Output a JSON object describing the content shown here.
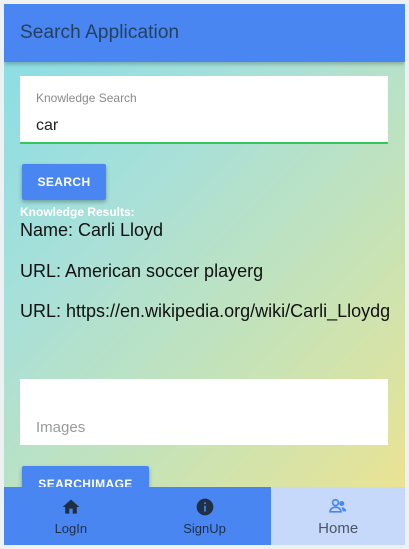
{
  "header": {
    "title": "Search Application"
  },
  "knowledge_search": {
    "label": "Knowledge Search",
    "value": "car"
  },
  "search_button": {
    "label": "SEARCH"
  },
  "results": {
    "heading": "Knowledge Results:",
    "name": "Name: Carli Lloyd",
    "description": "URL: American soccer playerg",
    "url": "URL: https://en.wikipedia.org/wiki/Carli_Lloydg"
  },
  "images_field": {
    "placeholder": "Images"
  },
  "searchimage_button": {
    "label": "SEARCHIMAGE"
  },
  "bottom_nav": {
    "items": [
      {
        "label": "LogIn",
        "icon": "home-icon"
      },
      {
        "label": "SignUp",
        "icon": "info-icon"
      },
      {
        "label": "Home",
        "icon": "people-icon",
        "active": true
      }
    ]
  },
  "colors": {
    "primary": "#4a86f2",
    "active_nav": "#c6d9fb",
    "input_underline": "#35c759"
  }
}
